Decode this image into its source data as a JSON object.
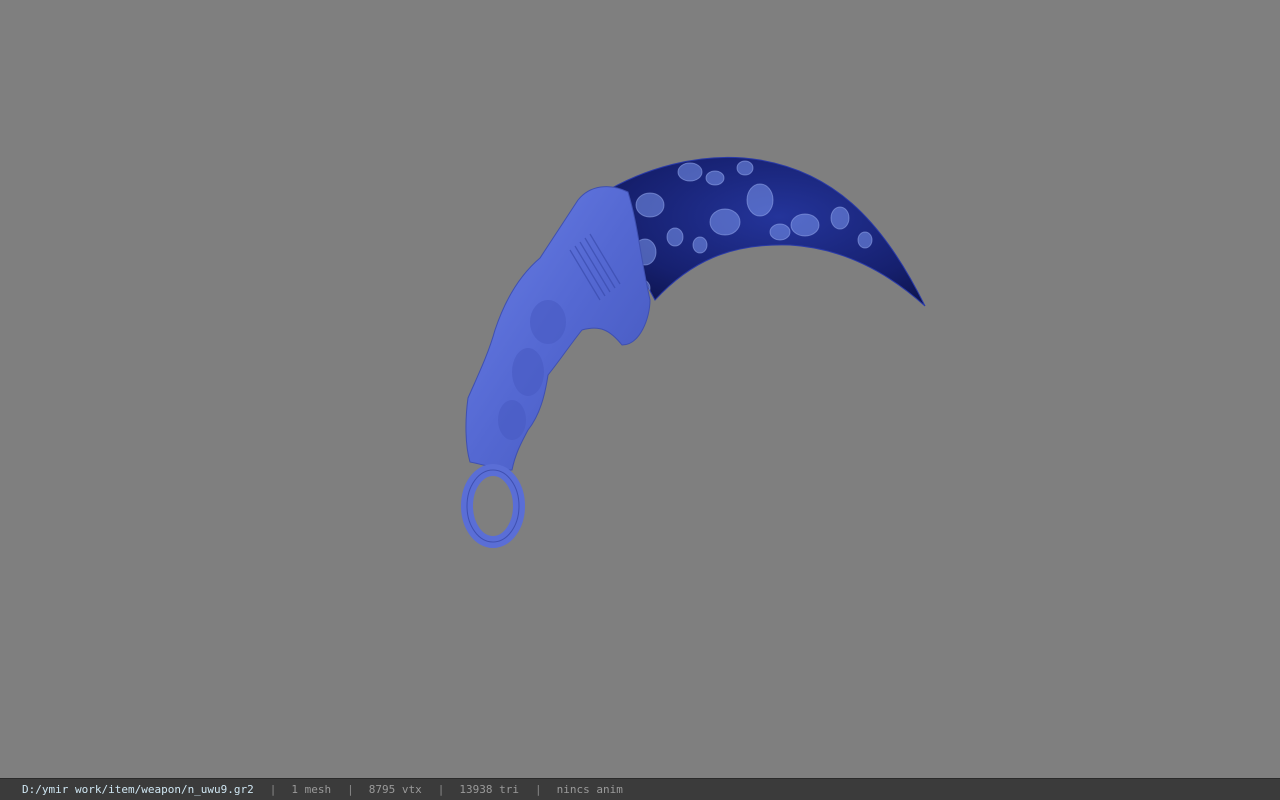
{
  "viewport": {
    "background_color": "#7f7f7f",
    "model": {
      "name": "karambit-knife-model",
      "handle_color": "#5a6fd6",
      "blade_color": "#1b2a8a",
      "pattern_color": "#6f8fe8"
    }
  },
  "statusbar": {
    "path": "D:/ymir work/item/weapon/n_uwu9.gr2",
    "separator": "|",
    "mesh_count": "1 mesh",
    "vertex_count": "8795 vtx",
    "triangle_count": "13938 tri",
    "animation": "nincs anim"
  }
}
